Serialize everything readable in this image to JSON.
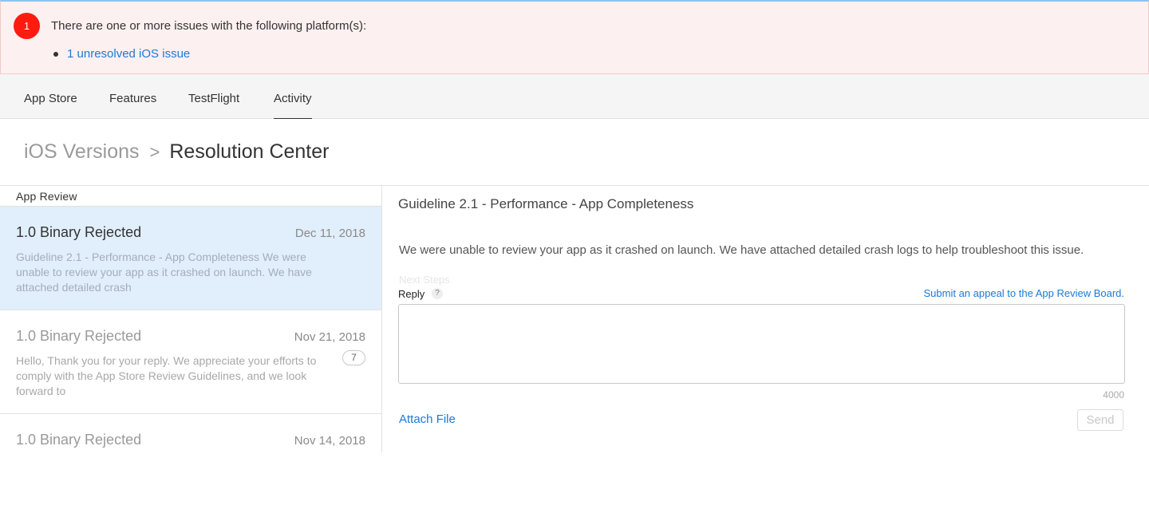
{
  "banner": {
    "badge_count": "1",
    "message": "There are one or more issues with the following platform(s):",
    "issue_link": "1 unresolved iOS issue",
    "colors": {
      "badge": "#ff1b0f",
      "background": "#fdf0f0",
      "link": "#1a7ad9"
    }
  },
  "tabs": [
    {
      "label": "App Store",
      "active": false
    },
    {
      "label": "Features",
      "active": false
    },
    {
      "label": "TestFlight",
      "active": false
    },
    {
      "label": "Activity",
      "active": true
    }
  ],
  "breadcrumb": {
    "parent": "iOS Versions",
    "separator": ">",
    "current": "Resolution Center"
  },
  "sidebar": {
    "heading": "App Review",
    "items": [
      {
        "title": "1.0 Binary Rejected",
        "date": "Dec 11, 2018",
        "selected": true,
        "preview": "Guideline 2.1 - Performance - App Completeness We were unable to review your app as it crashed on launch. We have attached detailed crash"
      },
      {
        "title": "1.0 Binary Rejected",
        "date": "Nov 21, 2018",
        "selected": false,
        "count": "7",
        "preview": "Hello, Thank you for your reply. We appreciate your efforts to comply with the App Store Review Guidelines, and we look forward to"
      },
      {
        "title": "1.0 Binary Rejected",
        "date": "Nov 14, 2018",
        "selected": false
      }
    ]
  },
  "detail": {
    "guideline": "Guideline 2.1 - Performance - App Completeness",
    "body": "We were unable to review your app as it crashed on launch. We have attached detailed crash logs to help troubleshoot this issue.",
    "faded_text": "Next Steps",
    "reply_label": "Reply",
    "help_icon": "?",
    "appeal_link": "Submit an appeal to the App Review Board.",
    "reply_value": "",
    "char_limit": "4000",
    "attach_label": "Attach File",
    "send_label": "Send"
  }
}
